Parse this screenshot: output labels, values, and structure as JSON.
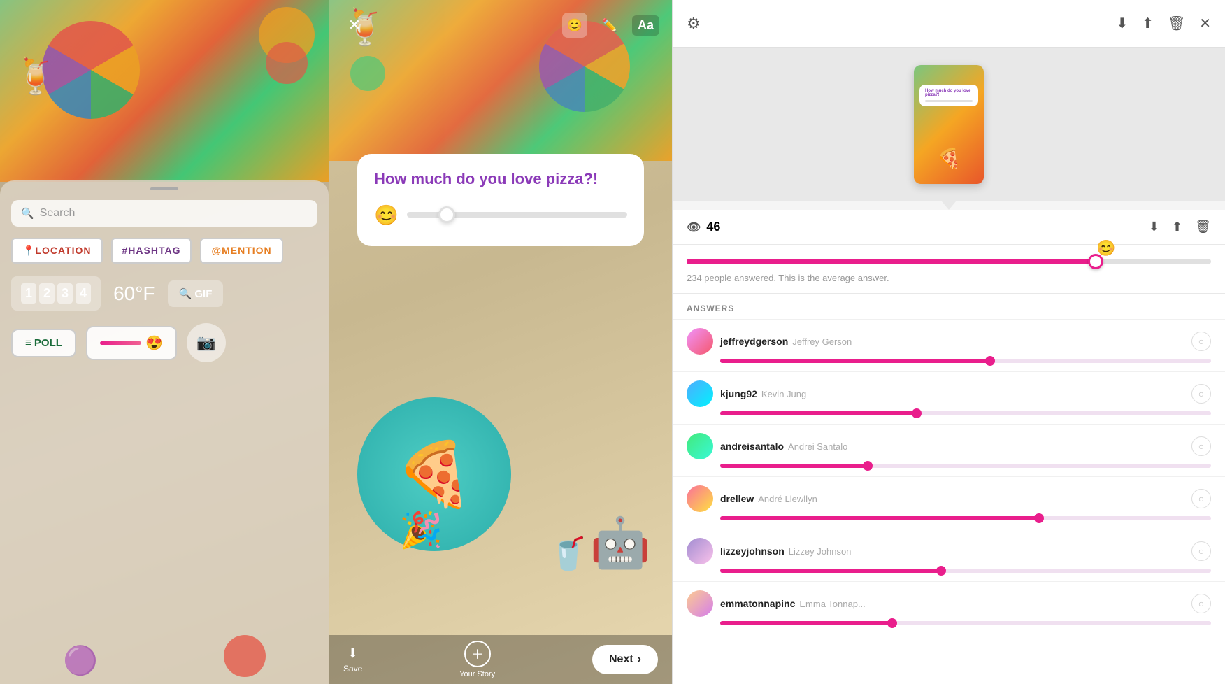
{
  "panel1": {
    "search_placeholder": "Search",
    "stickers": {
      "location_label": "📍LOCATION",
      "hashtag_label": "#HASHTAG",
      "mention_label": "@MENTION",
      "temp_label": "60°F",
      "gif_label": "🔍 GIF",
      "poll_label": "≡ POLL",
      "countdown": [
        "1",
        "2",
        "3",
        "4"
      ]
    }
  },
  "panel2": {
    "close_label": "✕",
    "aa_label": "Aa",
    "question": "How much do you love pizza?!",
    "slider_emoji": "😊",
    "save_label": "Save",
    "your_story_label": "Your Story",
    "next_label": "Next",
    "next_chevron": "›"
  },
  "panel3": {
    "views_count": "46",
    "avg_caption": "234 people answered. This is the average answer.",
    "answers_header": "ANSWERS",
    "slider_emoji": "😊",
    "answers": [
      {
        "username": "jeffreydgerson",
        "fullname": "Jeffrey Gerson",
        "slider_pct": 55,
        "avatar_class": "avatar1"
      },
      {
        "username": "kjung92",
        "fullname": "Kevin Jung",
        "slider_pct": 40,
        "avatar_class": "avatar2"
      },
      {
        "username": "andreisantalo",
        "fullname": "Andrei Santalo",
        "slider_pct": 30,
        "avatar_class": "avatar3"
      },
      {
        "username": "drellew",
        "fullname": "André Llewllyn",
        "slider_pct": 65,
        "avatar_class": "avatar4"
      },
      {
        "username": "lizzeyjohnson",
        "fullname": "Lizzey Johnson",
        "slider_pct": 45,
        "avatar_class": "avatar5"
      },
      {
        "username": "emmatonnapinc",
        "fullname": "Emma Tonnap...",
        "slider_pct": 35,
        "avatar_class": "avatar6"
      }
    ]
  }
}
